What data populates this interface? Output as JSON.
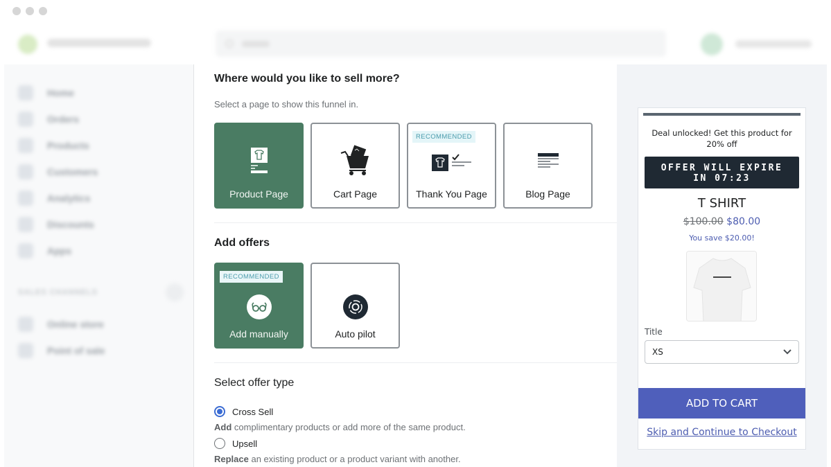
{
  "window": {
    "controls": [
      "close",
      "minimize",
      "maximize"
    ]
  },
  "topbar": {
    "store_name": "Shopify store (blurred)",
    "search_placeholder": "Search",
    "user_name": "Account (blurred)"
  },
  "sidebar": {
    "items": [
      {
        "label": "Home",
        "icon": "home-icon"
      },
      {
        "label": "Orders",
        "icon": "orders-icon"
      },
      {
        "label": "Products",
        "icon": "tag-icon"
      },
      {
        "label": "Customers",
        "icon": "person-icon"
      },
      {
        "label": "Analytics",
        "icon": "chart-icon"
      },
      {
        "label": "Discounts",
        "icon": "discount-icon"
      },
      {
        "label": "Apps",
        "icon": "apps-icon"
      }
    ],
    "sales_channels_label": "SALES CHANNELS",
    "channels": [
      {
        "label": "Online store",
        "icon": "store-icon"
      },
      {
        "label": "Point of sale",
        "icon": "pos-icon"
      }
    ]
  },
  "main": {
    "sell_section": {
      "title": "Where would you like to sell more?",
      "subtitle": "Select a page to show this funnel in.",
      "pages": [
        {
          "label": "Product Page",
          "selected": true,
          "badge": null,
          "icon": "product-page-icon"
        },
        {
          "label": "Cart Page",
          "selected": false,
          "badge": null,
          "icon": "cart-icon"
        },
        {
          "label": "Thank You Page",
          "selected": false,
          "badge": "RECOMMENDED",
          "icon": "thank-you-icon"
        },
        {
          "label": "Blog Page",
          "selected": false,
          "badge": null,
          "icon": "blog-icon"
        }
      ]
    },
    "offers_section": {
      "title": "Add offers",
      "options": [
        {
          "label": "Add manually",
          "selected": true,
          "badge": "RECOMMENDED",
          "icon": "glasses-icon"
        },
        {
          "label": "Auto pilot",
          "selected": false,
          "badge": null,
          "icon": "autopilot-icon"
        }
      ]
    },
    "offer_type_section": {
      "title": "Select offer type",
      "options": [
        {
          "label": "Cross Sell",
          "checked": true,
          "desc_bold": "Add",
          "desc": " complimentary products or add more of the same product."
        },
        {
          "label": "Upsell",
          "checked": false,
          "desc_bold": "Replace",
          "desc": " an existing product or a product variant with another."
        }
      ]
    }
  },
  "preview": {
    "deal_text": "Deal unlocked! Get this product for 20% off",
    "timer_line1": "OFFER WILL EXPIRE",
    "timer_line2": "IN 07:23",
    "product_title": "T SHIRT",
    "old_price": "$100.00",
    "new_price": "$80.00",
    "savings": "You save $20.00!",
    "variant_label": "Title",
    "variant_value": "XS",
    "add_to_cart": "ADD TO CART",
    "skip_link": "Skip and Continue to Checkout",
    "colors": {
      "accent": "#4f5fbb",
      "price": "#4c5cb0",
      "timer_bg": "#1f2933"
    }
  },
  "colors": {
    "selected_card": "#4a7c63",
    "radio_checked": "#3b6cd3",
    "badge_text": "#4a9bac"
  }
}
